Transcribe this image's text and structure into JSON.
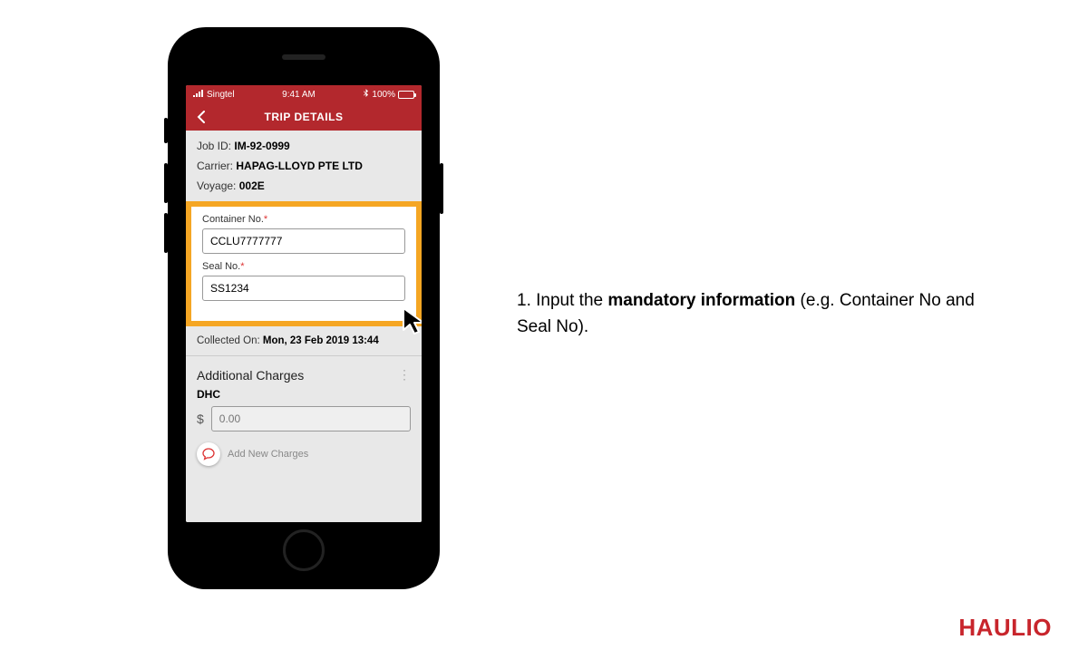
{
  "statusbar": {
    "carrier": "Singtel",
    "time": "9:41 AM",
    "battery": "100%"
  },
  "nav": {
    "title": "TRIP DETAILS"
  },
  "info": {
    "job_label": "Job ID:",
    "job_value": "IM-92-0999",
    "carrier_label": "Carrier:",
    "carrier_value": "HAPAG-LLOYD PTE LTD",
    "voyage_label": "Voyage:",
    "voyage_value": "002E"
  },
  "fields": {
    "container_label": "Container No.",
    "container_value": "CCLU7777777",
    "seal_label": "Seal No.",
    "seal_value": "SS1234",
    "required_mark": "*"
  },
  "collected": {
    "label": "Collected On:",
    "value": "Mon, 23 Feb 2019 13:44"
  },
  "charges": {
    "section_title": "Additional Charges",
    "sub_label": "DHC",
    "currency": "$",
    "placeholder": "0.00",
    "add_label": "Add New Charges"
  },
  "instruction": {
    "prefix": "1. Input the ",
    "bold": "mandatory information",
    "suffix": " (e.g. Container No and Seal No)."
  },
  "brand": "HAULIO"
}
